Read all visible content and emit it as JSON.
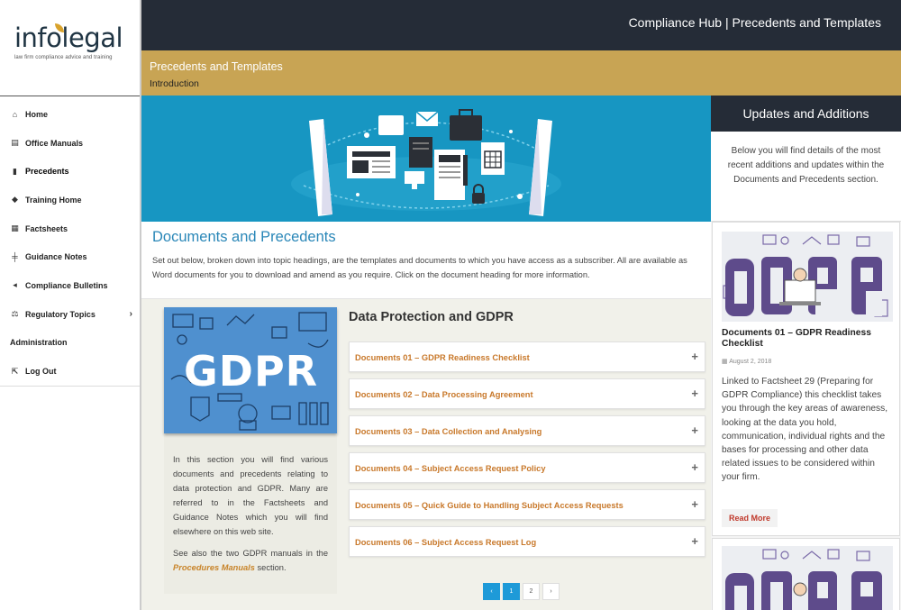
{
  "brand": {
    "logo_main": "infolegal",
    "tagline": "law firm compliance advice and training",
    "accent_gold": "#c8a454",
    "dark": "#252c37",
    "link_orange": "#c8782a",
    "hero_blue": "#1796c2"
  },
  "sidebar": {
    "items": [
      {
        "label": "Home",
        "icon": "home-icon"
      },
      {
        "label": "Office Manuals",
        "icon": "book-icon"
      },
      {
        "label": "Precedents",
        "icon": "document-icon"
      },
      {
        "label": "Training Home",
        "icon": "graduation-cap-icon"
      },
      {
        "label": "Factsheets",
        "icon": "newspaper-icon"
      },
      {
        "label": "Guidance Notes",
        "icon": "signpost-icon"
      },
      {
        "label": "Compliance Bulletins",
        "icon": "bullhorn-icon"
      },
      {
        "label": "Regulatory Topics",
        "icon": "scales-icon"
      },
      {
        "label": "Administration",
        "icon": ""
      },
      {
        "label": "Log Out",
        "icon": "logout-icon"
      }
    ]
  },
  "topbar": {
    "title": "Compliance Hub | Precedents and Templates"
  },
  "page": {
    "title": "Precedents and Templates",
    "subtitle": "Introduction"
  },
  "documents": {
    "heading": "Documents and Precedents",
    "description": "Set out below, broken down into topic headings, are the templates and documents to which you have access as a subscriber.  All are available as Word documents for you to download and amend as you require. Click on the document heading for more information."
  },
  "gdpr": {
    "image_text": "GDPR",
    "paragraph1": "In this section you will find various documents and precedents relating to data protection and GDPR. Many are referred to in the Factsheets and Guidance Notes which you will find elsewhere on this web site.",
    "paragraph2_before": "See also the two GDPR manuals in the ",
    "paragraph2_link": "Procedures Manuals",
    "paragraph2_after": " section.",
    "heading": "Data Protection and GDPR",
    "documents": [
      "Documents 01 – GDPR Readiness Checklist",
      "Documents 02 – Data Processing Agreement",
      "Documents 03 – Data Collection and Analysing",
      "Documents 04 – Subject Access Request Policy",
      "Documents 05 – Quick Guide to Handling Subject Access Requests",
      "Documents 06 – Subject Access Request Log"
    ]
  },
  "pagination": {
    "prev": "‹",
    "pages": [
      "1",
      "2"
    ],
    "next": "›"
  },
  "updates": {
    "heading": "Updates and Additions",
    "description": "Below you will find details of the most recent additions and updates within the Documents and Precedents section.",
    "card": {
      "image_text": "GDPR",
      "title": "Documents 01 – GDPR Readiness Checklist",
      "date": "August 2, 2018",
      "text": "Linked to Factsheet 29 (Preparing for GDPR Compliance) this checklist takes you through the key areas of awareness, looking at the data you hold, communication, individual rights and the bases for processing and other data related issues to be considered within your firm.",
      "read_more": "Read More"
    }
  }
}
